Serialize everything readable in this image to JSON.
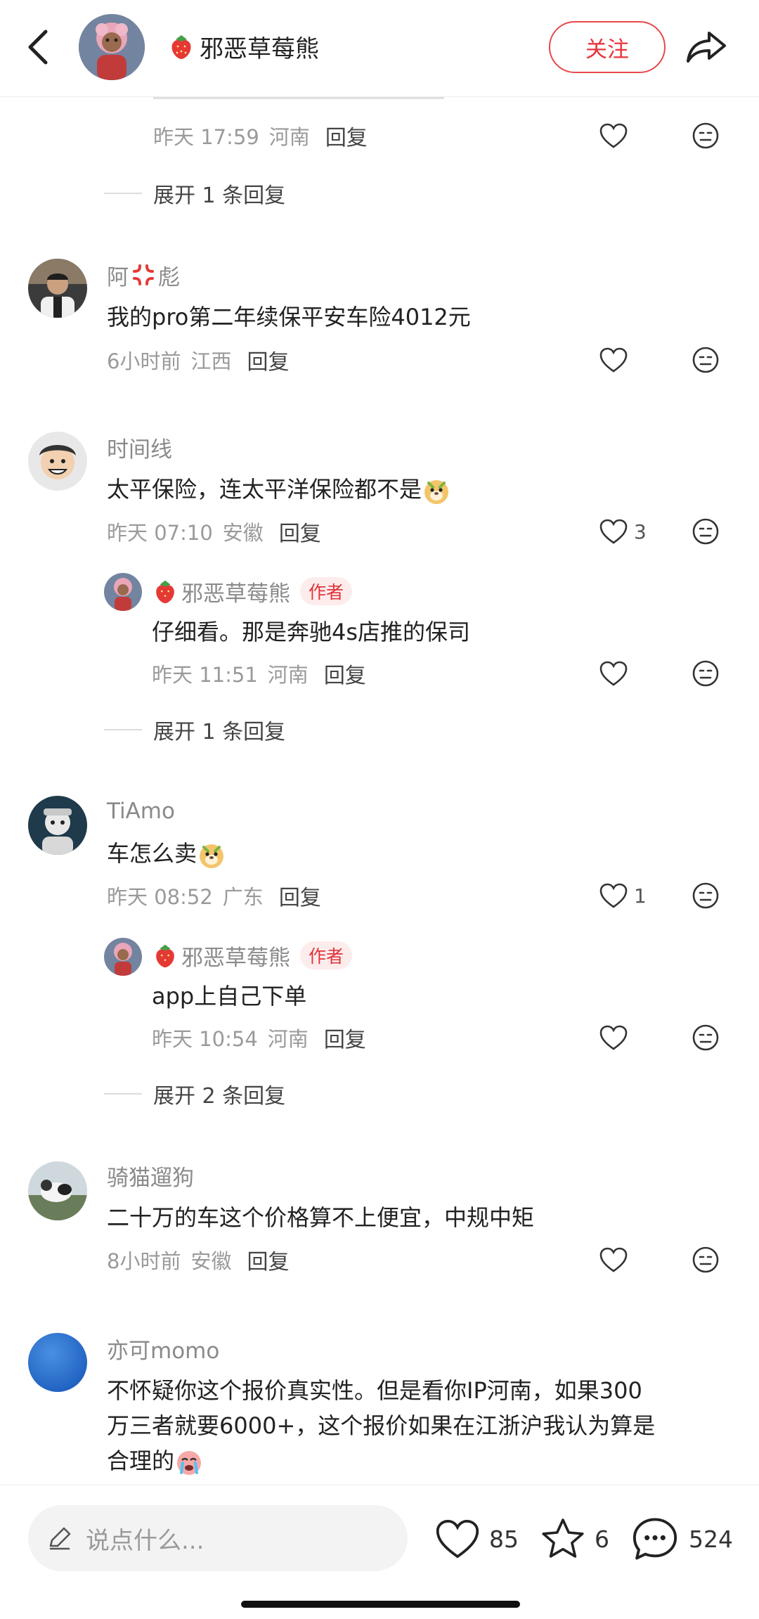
{
  "header": {
    "author_name": "邪恶草莓熊",
    "follow_label": "关注"
  },
  "comments": [
    {
      "kind": "tail",
      "time": "昨天 17:59",
      "location": "河南",
      "reply_label": "回复",
      "expand_label": "展开 1 条回复"
    },
    {
      "username_prefix": "阿",
      "username_suffix": "彪",
      "text": "我的pro第二年续保平安车险4012元",
      "time": "6小时前",
      "location": "江西",
      "reply_label": "回复"
    },
    {
      "username": "时间线",
      "text": "太平保险，连太平洋保险都不是",
      "time": "昨天 07:10",
      "location": "安徽",
      "reply_label": "回复",
      "likes": "3",
      "reply": {
        "username": "邪恶草莓熊",
        "tag": "作者",
        "text": "仔细看。那是奔驰4s店推的保司",
        "time": "昨天 11:51",
        "location": "河南",
        "reply_label": "回复"
      },
      "expand_label": "展开 1 条回复"
    },
    {
      "username": "TiAmo",
      "text": "车怎么卖",
      "time": "昨天 08:52",
      "location": "广东",
      "reply_label": "回复",
      "likes": "1",
      "reply": {
        "username": "邪恶草莓熊",
        "tag": "作者",
        "text": "app上自己下单",
        "time": "昨天 10:54",
        "location": "河南",
        "reply_label": "回复"
      },
      "expand_label": "展开 2 条回复"
    },
    {
      "username": "骑猫遛狗",
      "text": "二十万的车这个价格算不上便宜，中规中矩",
      "time": "8小时前",
      "location": "安徽",
      "reply_label": "回复"
    },
    {
      "username": "亦可momo",
      "text_lines": [
        "不怀疑你这个报价真实性。但是看你IP河南，如果300",
        "万三者就要6000+，这个报价如果在江浙沪我认为算是",
        "合理的"
      ]
    }
  ],
  "bottom_bar": {
    "input_placeholder": "说点什么...",
    "like_count": "85",
    "collect_count": "6",
    "comment_count": "524"
  },
  "colors": {
    "accent_red": "#e8343a",
    "author_tag_bg": "#fdecec",
    "meta_gray": "#9a9a9a"
  },
  "icons": [
    "back-arrow-icon",
    "share-icon",
    "heart-icon",
    "dislike-face-icon",
    "strawberry-icon",
    "anger-icon",
    "meerkat-emoji-icon",
    "crying-emoji-icon",
    "pencil-icon",
    "star-icon",
    "comment-bubble-icon"
  ]
}
